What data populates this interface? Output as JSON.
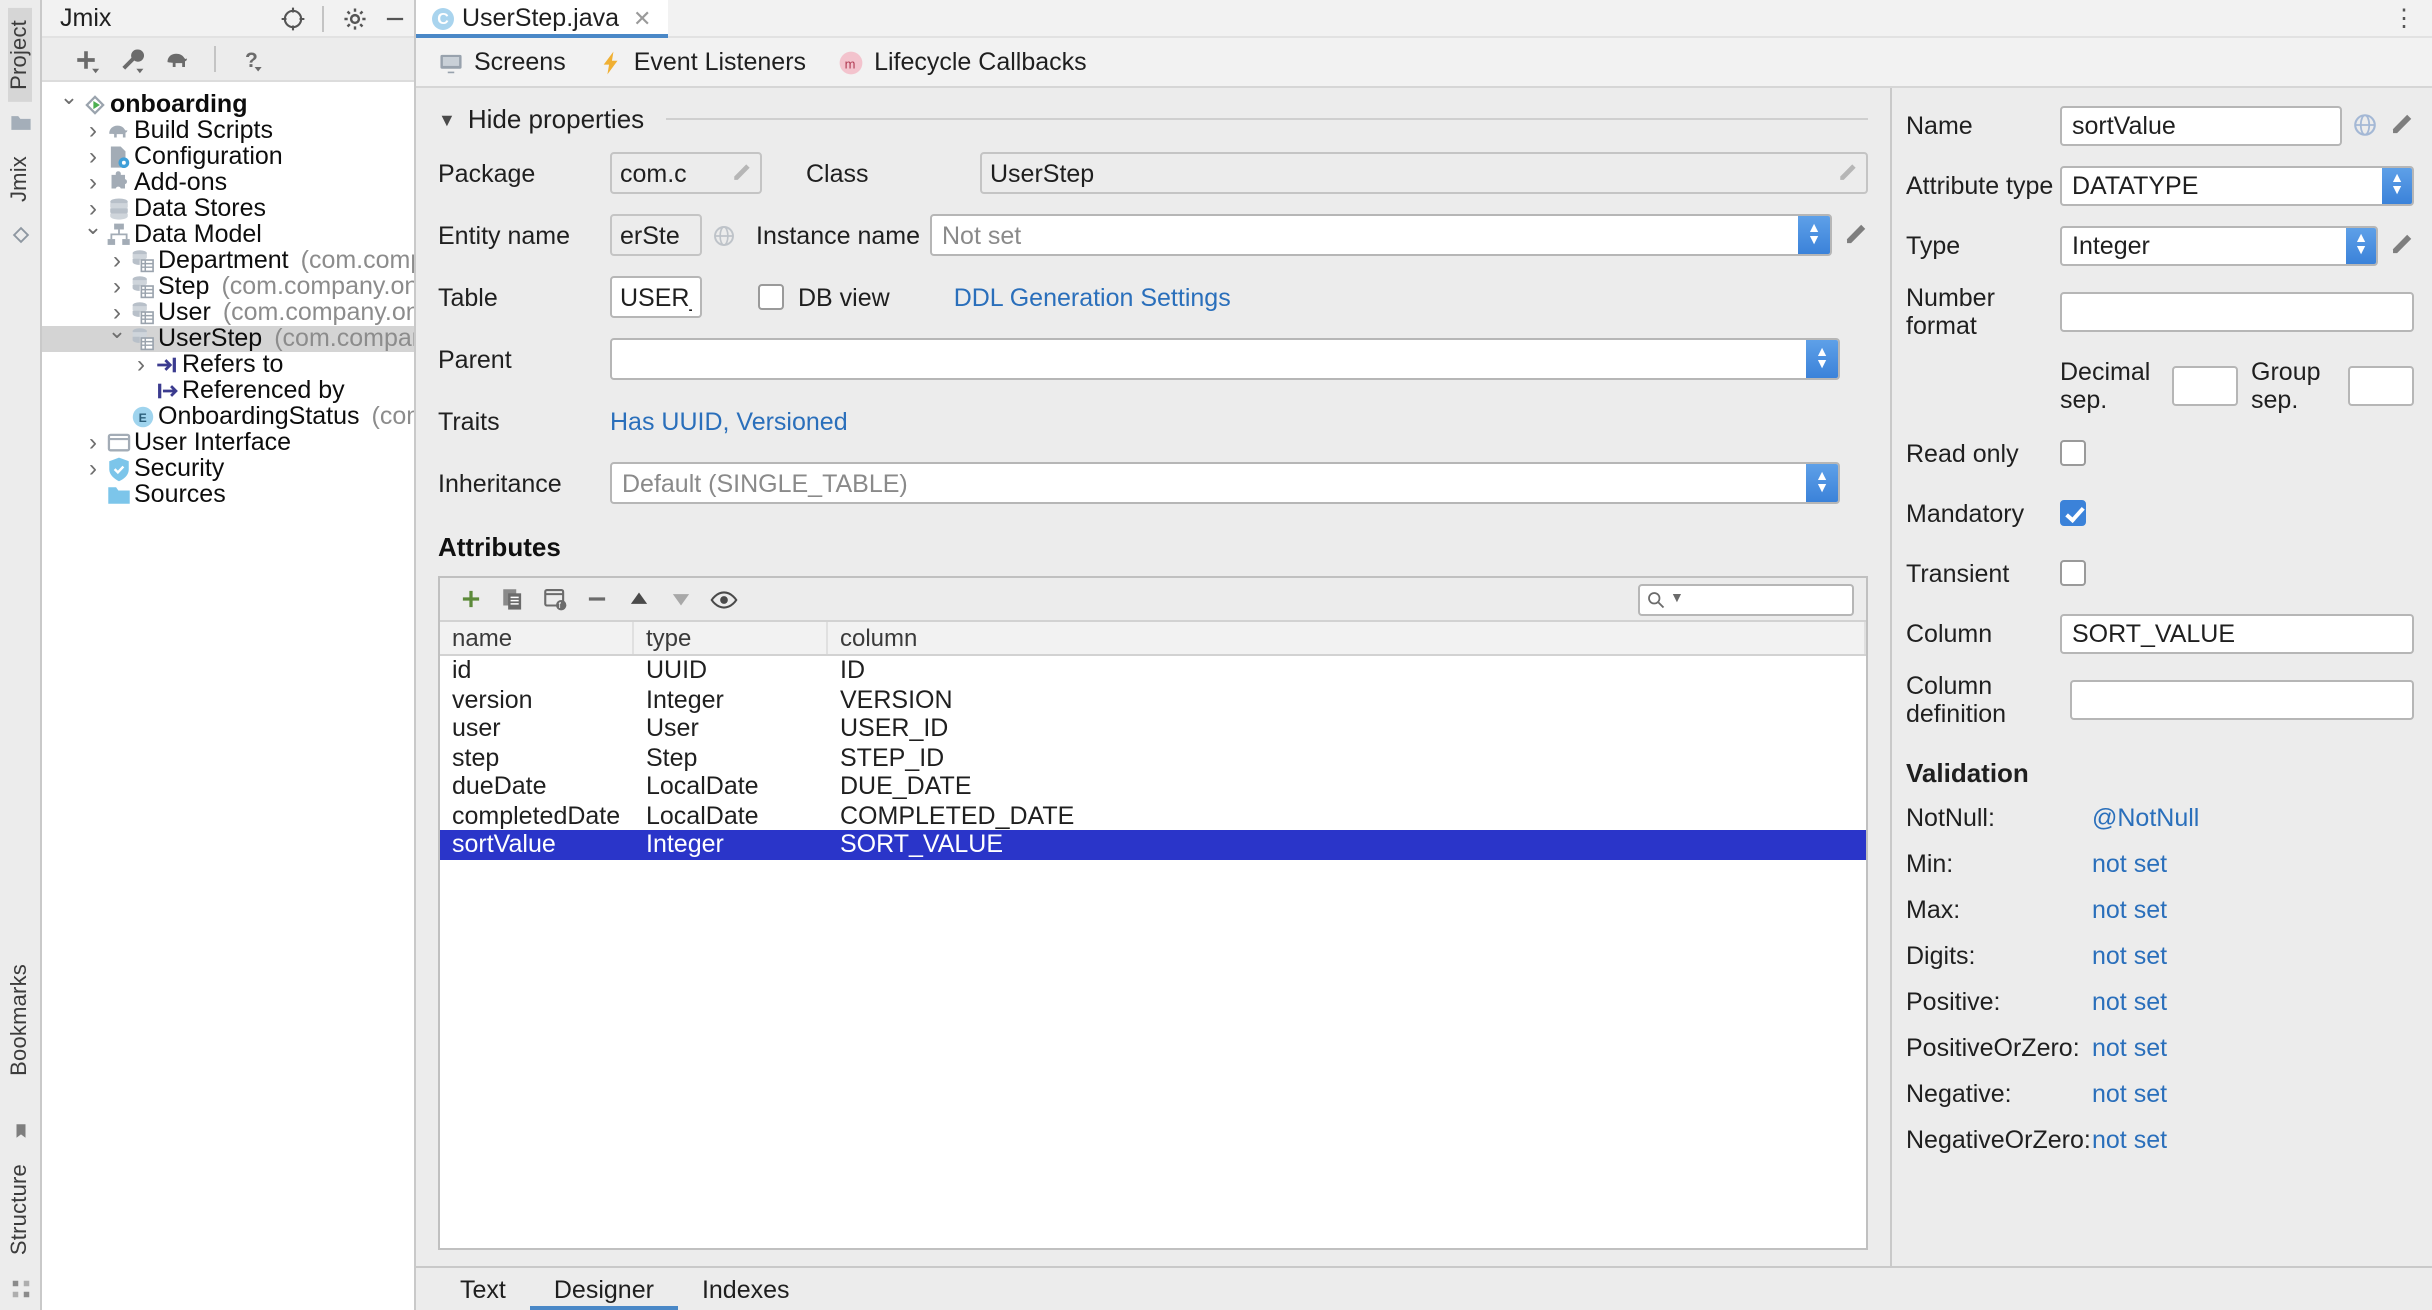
{
  "rail": {
    "left_labels": [
      "Project",
      "Jmix",
      "Bookmarks",
      "Structure"
    ]
  },
  "project_panel": {
    "title": "Jmix",
    "toolbar": [
      {
        "name": "add-button",
        "icon": "plus-icon"
      },
      {
        "name": "build-tools-button",
        "icon": "wrench-icon"
      },
      {
        "name": "gradle-button",
        "icon": "elephant-icon"
      },
      {
        "name": "help-button",
        "icon": "question-icon"
      }
    ],
    "tree": [
      {
        "depth": 0,
        "chev": "open",
        "icon": "project-icon",
        "label": "onboarding",
        "pkg": "",
        "bold": true,
        "selected": false
      },
      {
        "depth": 1,
        "chev": "closed",
        "icon": "gradle-icon",
        "label": "Build Scripts",
        "pkg": "",
        "bold": false,
        "selected": false
      },
      {
        "depth": 1,
        "chev": "closed",
        "icon": "config-icon",
        "label": "Configuration",
        "pkg": "",
        "bold": false,
        "selected": false
      },
      {
        "depth": 1,
        "chev": "closed",
        "icon": "addon-icon",
        "label": "Add-ons",
        "pkg": "",
        "bold": false,
        "selected": false
      },
      {
        "depth": 1,
        "chev": "closed",
        "icon": "datastore-icon",
        "label": "Data Stores",
        "pkg": "",
        "bold": false,
        "selected": false
      },
      {
        "depth": 1,
        "chev": "open",
        "icon": "datamodel-icon",
        "label": "Data Model",
        "pkg": "",
        "bold": false,
        "selected": false
      },
      {
        "depth": 2,
        "chev": "closed",
        "icon": "entity-icon",
        "label": "Department",
        "pkg": "(com.company.onboard",
        "bold": false,
        "selected": false
      },
      {
        "depth": 2,
        "chev": "closed",
        "icon": "entity-icon",
        "label": "Step",
        "pkg": "(com.company.onboarding.ent",
        "bold": false,
        "selected": false
      },
      {
        "depth": 2,
        "chev": "closed",
        "icon": "entity-icon",
        "label": "User",
        "pkg": "(com.company.onboarding.ent",
        "bold": false,
        "selected": false
      },
      {
        "depth": 2,
        "chev": "open",
        "icon": "entity-icon",
        "label": "UserStep",
        "pkg": "(com.company.onboardin",
        "bold": false,
        "selected": true
      },
      {
        "depth": 3,
        "chev": "closed",
        "icon": "refers-to-icon",
        "label": "Refers to",
        "pkg": "",
        "bold": false,
        "selected": false
      },
      {
        "depth": 3,
        "chev": "blank",
        "icon": "referenced-by-icon",
        "label": "Referenced by",
        "pkg": "",
        "bold": false,
        "selected": false
      },
      {
        "depth": 2,
        "chev": "blank",
        "icon": "enum-icon",
        "label": "OnboardingStatus",
        "pkg": "(com.company.o",
        "bold": false,
        "selected": false
      },
      {
        "depth": 1,
        "chev": "closed",
        "icon": "ui-icon",
        "label": "User Interface",
        "pkg": "",
        "bold": false,
        "selected": false
      },
      {
        "depth": 1,
        "chev": "closed",
        "icon": "security-icon",
        "label": "Security",
        "pkg": "",
        "bold": false,
        "selected": false
      },
      {
        "depth": 1,
        "chev": "blank",
        "icon": "folder-icon",
        "label": "Sources",
        "pkg": "",
        "bold": false,
        "selected": false
      }
    ]
  },
  "editor": {
    "tab": {
      "label": "UserStep.java",
      "icon_letter": "C"
    },
    "subtabs": [
      {
        "label": "Screens",
        "icon": "monitor-icon"
      },
      {
        "label": "Event Listeners",
        "icon": "lightning-icon"
      },
      {
        "label": "Lifecycle Callbacks",
        "icon": "m-circle-icon"
      }
    ],
    "hide_properties_label": "Hide properties",
    "form": {
      "package_label": "Package",
      "package_value": "com.c",
      "class_label": "Class",
      "class_value": "UserStep",
      "entity_name_label": "Entity name",
      "entity_name_value": "erSte",
      "instance_name_label": "Instance name",
      "instance_name_value": "Not set",
      "table_label": "Table",
      "table_value": "USER_ST",
      "db_view_label": "DB view",
      "db_view_checked": false,
      "ddl_link": "DDL Generation Settings",
      "parent_label": "Parent",
      "parent_value": "",
      "traits_label": "Traits",
      "traits_value": "Has UUID, Versioned",
      "inheritance_label": "Inheritance",
      "inheritance_value": "Default (SINGLE_TABLE)"
    },
    "attributes": {
      "title": "Attributes",
      "toolbar": [
        {
          "name": "add-attribute-button",
          "icon": "plus-icon"
        },
        {
          "name": "copy-attribute-button",
          "icon": "copy-icon"
        },
        {
          "name": "add-composition-button",
          "icon": "window-f-icon"
        },
        {
          "name": "remove-attribute-button",
          "icon": "minus-icon"
        },
        {
          "name": "move-up-button",
          "icon": "arrow-up-icon"
        },
        {
          "name": "move-down-button",
          "icon": "arrow-down-icon"
        },
        {
          "name": "preview-button",
          "icon": "eye-icon"
        }
      ],
      "search_placeholder": "",
      "columns": [
        "name",
        "type",
        "column"
      ],
      "rows": [
        {
          "name": "id",
          "type": "UUID",
          "column": "ID",
          "selected": false
        },
        {
          "name": "version",
          "type": "Integer",
          "column": "VERSION",
          "selected": false
        },
        {
          "name": "user",
          "type": "User",
          "column": "USER_ID",
          "selected": false
        },
        {
          "name": "step",
          "type": "Step",
          "column": "STEP_ID",
          "selected": false
        },
        {
          "name": "dueDate",
          "type": "LocalDate",
          "column": "DUE_DATE",
          "selected": false
        },
        {
          "name": "completedDate",
          "type": "LocalDate",
          "column": "COMPLETED_DATE",
          "selected": false
        },
        {
          "name": "sortValue",
          "type": "Integer",
          "column": "SORT_VALUE",
          "selected": true
        }
      ]
    },
    "bottom_tabs": [
      {
        "label": "Text",
        "active": false
      },
      {
        "label": "Designer",
        "active": true
      },
      {
        "label": "Indexes",
        "active": false
      }
    ]
  },
  "properties": {
    "name_label": "Name",
    "name_value": "sortValue",
    "attribute_type_label": "Attribute type",
    "attribute_type_value": "DATATYPE",
    "type_label": "Type",
    "type_value": "Integer",
    "number_format_label": "Number format",
    "number_format_value": "",
    "decimal_sep_label": "Decimal sep.",
    "decimal_sep_value": "",
    "group_sep_label": "Group sep.",
    "group_sep_value": "",
    "read_only_label": "Read only",
    "read_only_checked": false,
    "mandatory_label": "Mandatory",
    "mandatory_checked": true,
    "transient_label": "Transient",
    "transient_checked": false,
    "column_label": "Column",
    "column_value": "SORT_VALUE",
    "column_definition_label": "Column definition",
    "column_definition_value": "",
    "validation_title": "Validation",
    "validation": [
      {
        "label": "NotNull:",
        "value": "@NotNull"
      },
      {
        "label": "Min:",
        "value": "not set"
      },
      {
        "label": "Max:",
        "value": "not set"
      },
      {
        "label": "Digits:",
        "value": "not set"
      },
      {
        "label": "Positive:",
        "value": "not set"
      },
      {
        "label": "PositiveOrZero:",
        "value": "not set"
      },
      {
        "label": "Negative:",
        "value": "not set"
      },
      {
        "label": "NegativeOrZero:",
        "value": "not set"
      }
    ]
  },
  "colors": {
    "accent_blue": "#3b82d9",
    "link_blue": "#2a6fbb",
    "selection_blue": "#2a35c9",
    "tab_underline": "#4a88c7",
    "panel_bg": "#ececec"
  }
}
